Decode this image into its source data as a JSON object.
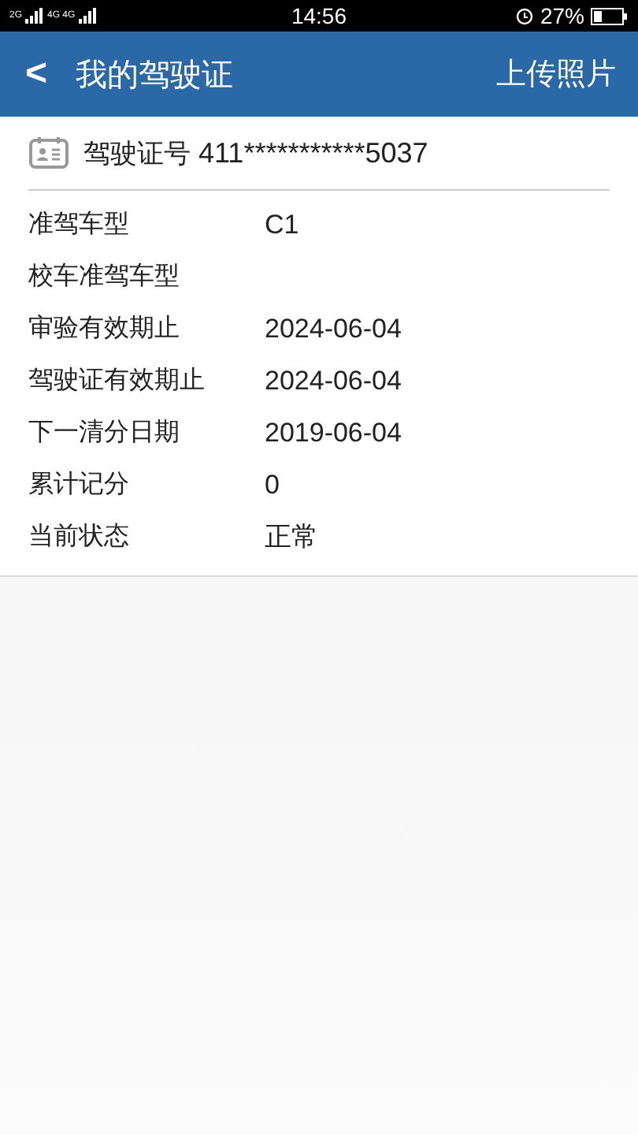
{
  "status_bar": {
    "network_1": "2G",
    "network_2": "4G 4G",
    "time": "14:56",
    "battery": "27%"
  },
  "nav": {
    "back": "<",
    "title": "我的驾驶证",
    "action": "上传照片"
  },
  "license": {
    "label": "驾驶证号",
    "number": "411***********5037"
  },
  "fields": [
    {
      "label": "准驾车型",
      "value": "C1"
    },
    {
      "label": "校车准驾车型"
    },
    {
      "label": "审验有效期止",
      "value": "2024-06-04"
    },
    {
      "label": "驾驶证有效期止",
      "value": "2024-06-04"
    },
    {
      "label": "下一清分日期",
      "value": "2019-06-04"
    },
    {
      "label": "累计记分",
      "value": "0"
    },
    {
      "label": "当前状态",
      "value": "正常"
    }
  ]
}
